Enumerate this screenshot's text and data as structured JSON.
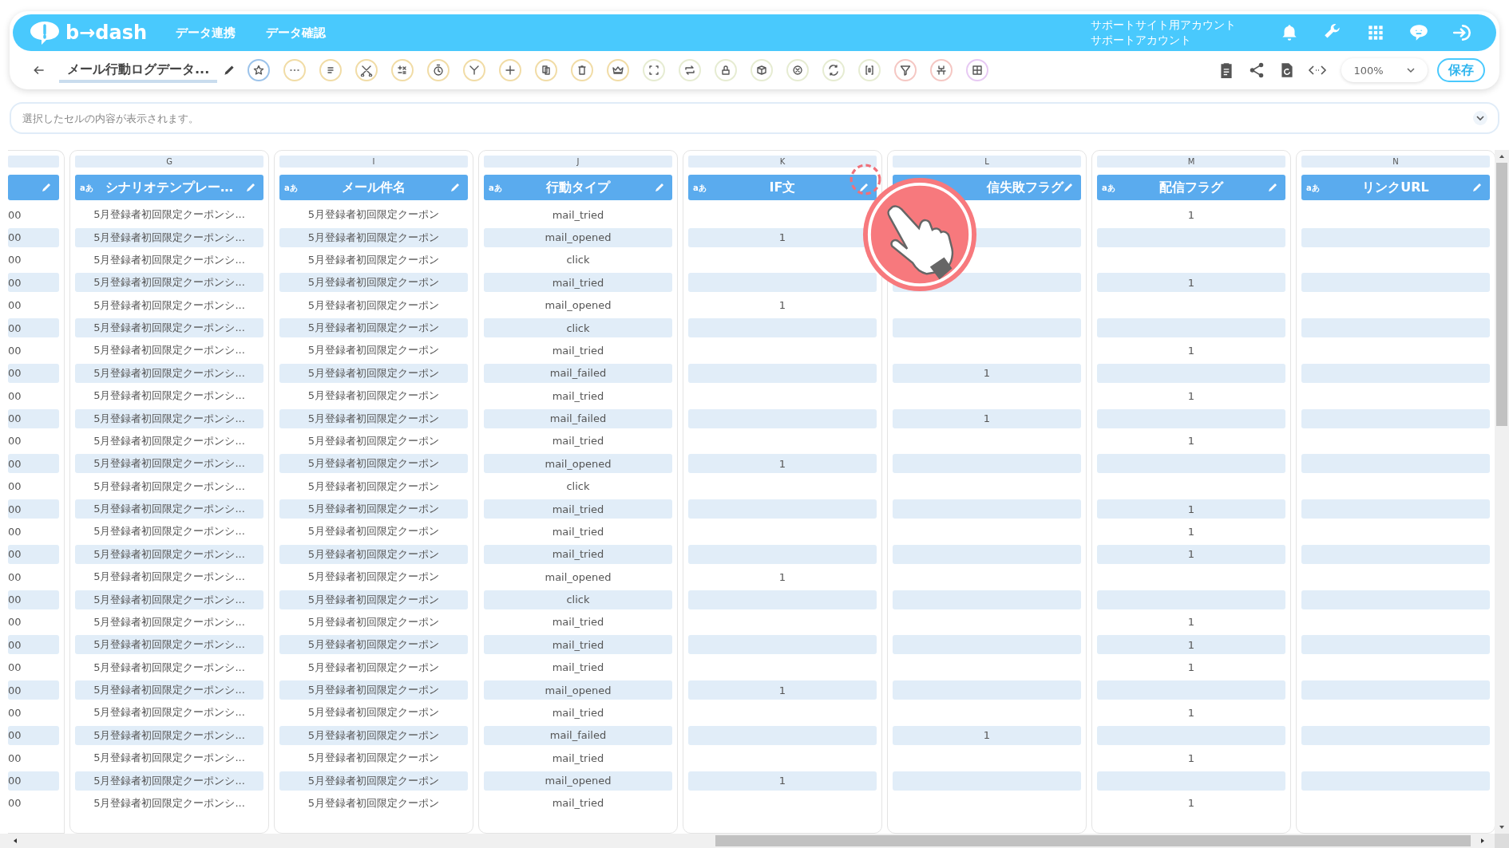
{
  "header": {
    "logo": "b→dash",
    "nav": [
      "データ連携",
      "データ確認"
    ],
    "account": [
      "サポートサイト用アカウント",
      "サポートアカウント"
    ]
  },
  "toolbar": {
    "title": "メール行動ログデータ...",
    "zoom": "100%",
    "save": "保存"
  },
  "cell_viewer": {
    "placeholder": "選択したセルの内容が表示されます。"
  },
  "columns": [
    {},
    {
      "letter": "G",
      "type_label": "aあ",
      "name": "シナリオテンプレー…"
    },
    {
      "letter": "I",
      "type_label": "aあ",
      "name": "メール件名"
    },
    {
      "letter": "J",
      "type_label": "aあ",
      "name": "行動タイプ"
    },
    {
      "letter": "K",
      "type_label": "aあ",
      "name": "IF文"
    },
    {
      "letter": "L",
      "name": "信失敗フラグ"
    },
    {
      "letter": "M",
      "type_label": "aあ",
      "name": "配信フラグ"
    },
    {
      "letter": "N",
      "type_label": "aあ",
      "name": "リンクURL"
    }
  ],
  "rows": [
    [
      "00",
      "5月登録者初回限定クーポンシ...",
      "5月登録者初回限定クーポン",
      "mail_tried",
      null,
      null,
      "1",
      null
    ],
    [
      "00",
      "5月登録者初回限定クーポンシ...",
      "5月登録者初回限定クーポン",
      "mail_opened",
      "1",
      null,
      null,
      null
    ],
    [
      "00",
      "5月登録者初回限定クーポンシ...",
      "5月登録者初回限定クーポン",
      "click",
      null,
      null,
      null,
      null
    ],
    [
      "00",
      "5月登録者初回限定クーポンシ...",
      "5月登録者初回限定クーポン",
      "mail_tried",
      null,
      null,
      "1",
      null
    ],
    [
      "00",
      "5月登録者初回限定クーポンシ...",
      "5月登録者初回限定クーポン",
      "mail_opened",
      "1",
      null,
      null,
      null
    ],
    [
      "00",
      "5月登録者初回限定クーポンシ...",
      "5月登録者初回限定クーポン",
      "click",
      null,
      null,
      null,
      null
    ],
    [
      "00",
      "5月登録者初回限定クーポンシ...",
      "5月登録者初回限定クーポン",
      "mail_tried",
      null,
      null,
      "1",
      null
    ],
    [
      "00",
      "5月登録者初回限定クーポンシ...",
      "5月登録者初回限定クーポン",
      "mail_failed",
      null,
      "1",
      null,
      null
    ],
    [
      "00",
      "5月登録者初回限定クーポンシ...",
      "5月登録者初回限定クーポン",
      "mail_tried",
      null,
      null,
      "1",
      null
    ],
    [
      "00",
      "5月登録者初回限定クーポンシ...",
      "5月登録者初回限定クーポン",
      "mail_failed",
      null,
      "1",
      null,
      null
    ],
    [
      "00",
      "5月登録者初回限定クーポンシ...",
      "5月登録者初回限定クーポン",
      "mail_tried",
      null,
      null,
      "1",
      null
    ],
    [
      "00",
      "5月登録者初回限定クーポンシ...",
      "5月登録者初回限定クーポン",
      "mail_opened",
      "1",
      null,
      null,
      null
    ],
    [
      "00",
      "5月登録者初回限定クーポンシ...",
      "5月登録者初回限定クーポン",
      "click",
      null,
      null,
      null,
      null
    ],
    [
      "00",
      "5月登録者初回限定クーポンシ...",
      "5月登録者初回限定クーポン",
      "mail_tried",
      null,
      null,
      "1",
      null
    ],
    [
      "00",
      "5月登録者初回限定クーポンシ...",
      "5月登録者初回限定クーポン",
      "mail_tried",
      null,
      null,
      "1",
      null
    ],
    [
      "00",
      "5月登録者初回限定クーポンシ...",
      "5月登録者初回限定クーポン",
      "mail_tried",
      null,
      null,
      "1",
      null
    ],
    [
      "00",
      "5月登録者初回限定クーポンシ...",
      "5月登録者初回限定クーポン",
      "mail_opened",
      "1",
      null,
      null,
      null
    ],
    [
      "00",
      "5月登録者初回限定クーポンシ...",
      "5月登録者初回限定クーポン",
      "click",
      null,
      null,
      null,
      null
    ],
    [
      "00",
      "5月登録者初回限定クーポンシ...",
      "5月登録者初回限定クーポン",
      "mail_tried",
      null,
      null,
      "1",
      null
    ],
    [
      "00",
      "5月登録者初回限定クーポンシ...",
      "5月登録者初回限定クーポン",
      "mail_tried",
      null,
      null,
      "1",
      null
    ],
    [
      "00",
      "5月登録者初回限定クーポンシ...",
      "5月登録者初回限定クーポン",
      "mail_tried",
      null,
      null,
      "1",
      null
    ],
    [
      "00",
      "5月登録者初回限定クーポンシ...",
      "5月登録者初回限定クーポン",
      "mail_opened",
      "1",
      null,
      null,
      null
    ],
    [
      "00",
      "5月登録者初回限定クーポンシ...",
      "5月登録者初回限定クーポン",
      "mail_tried",
      null,
      null,
      "1",
      null
    ],
    [
      "00",
      "5月登録者初回限定クーポンシ...",
      "5月登録者初回限定クーポン",
      "mail_failed",
      null,
      "1",
      null,
      null
    ],
    [
      "00",
      "5月登録者初回限定クーポンシ...",
      "5月登録者初回限定クーポン",
      "mail_tried",
      null,
      null,
      "1",
      null
    ],
    [
      "00",
      "5月登録者初回限定クーポンシ...",
      "5月登録者初回限定クーポン",
      "mail_opened",
      "1",
      null,
      null,
      null
    ],
    [
      "00",
      "5月登録者初回限定クーポンシ...",
      "5月登録者初回限定クーポン",
      "mail_tried",
      null,
      null,
      "1",
      null
    ]
  ]
}
